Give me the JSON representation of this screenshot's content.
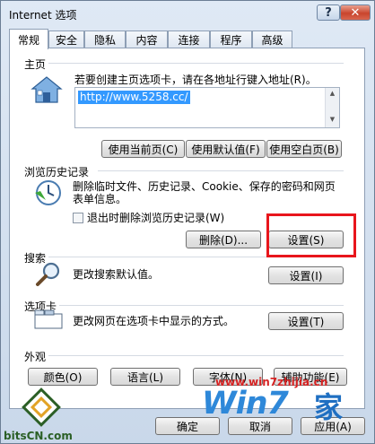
{
  "window": {
    "title": "Internet 选项"
  },
  "titlebar": {
    "help_glyph": "?",
    "close_glyph": "✕"
  },
  "tabs": [
    "常规",
    "安全",
    "隐私",
    "内容",
    "连接",
    "程序",
    "高级"
  ],
  "home": {
    "section_title": "主页",
    "description": "若要创建主页选项卡，请在各地址行键入地址(R)。",
    "url": "http://www.5258.cc/",
    "buttons": {
      "use_current": "使用当前页(C)",
      "use_default": "使用默认值(F)",
      "use_blank": "使用空白页(B)"
    }
  },
  "history": {
    "section_title": "浏览历史记录",
    "description_line1": "删除临时文件、历史记录、Cookie、保存的密码和网页",
    "description_line2": "表单信息。",
    "checkbox_label": "退出时删除浏览历史记录(W)",
    "delete_button": "删除(D)...",
    "settings_button": "设置(S)"
  },
  "search": {
    "section_title": "搜索",
    "description": "更改搜索默认值。",
    "settings_button": "设置(I)"
  },
  "tabs_section": {
    "section_title": "选项卡",
    "description": "更改网页在选项卡中显示的方式。",
    "settings_button": "设置(T)"
  },
  "appearance": {
    "section_title": "外观",
    "buttons": {
      "colors": "颜色(O)",
      "languages": "语言(L)",
      "fonts": "字体(N)",
      "accessibility": "辅助功能(E)"
    }
  },
  "footer": {
    "ok": "确定",
    "cancel": "取消",
    "apply": "应用(A)"
  },
  "watermarks": {
    "bits": "bitsCN.com",
    "win7": "Win7",
    "win7_url": "www.win7zhijia.cn",
    "jia": "家"
  },
  "colors": {
    "highlight": "#e8161c",
    "url_selection": "#3399ff"
  }
}
